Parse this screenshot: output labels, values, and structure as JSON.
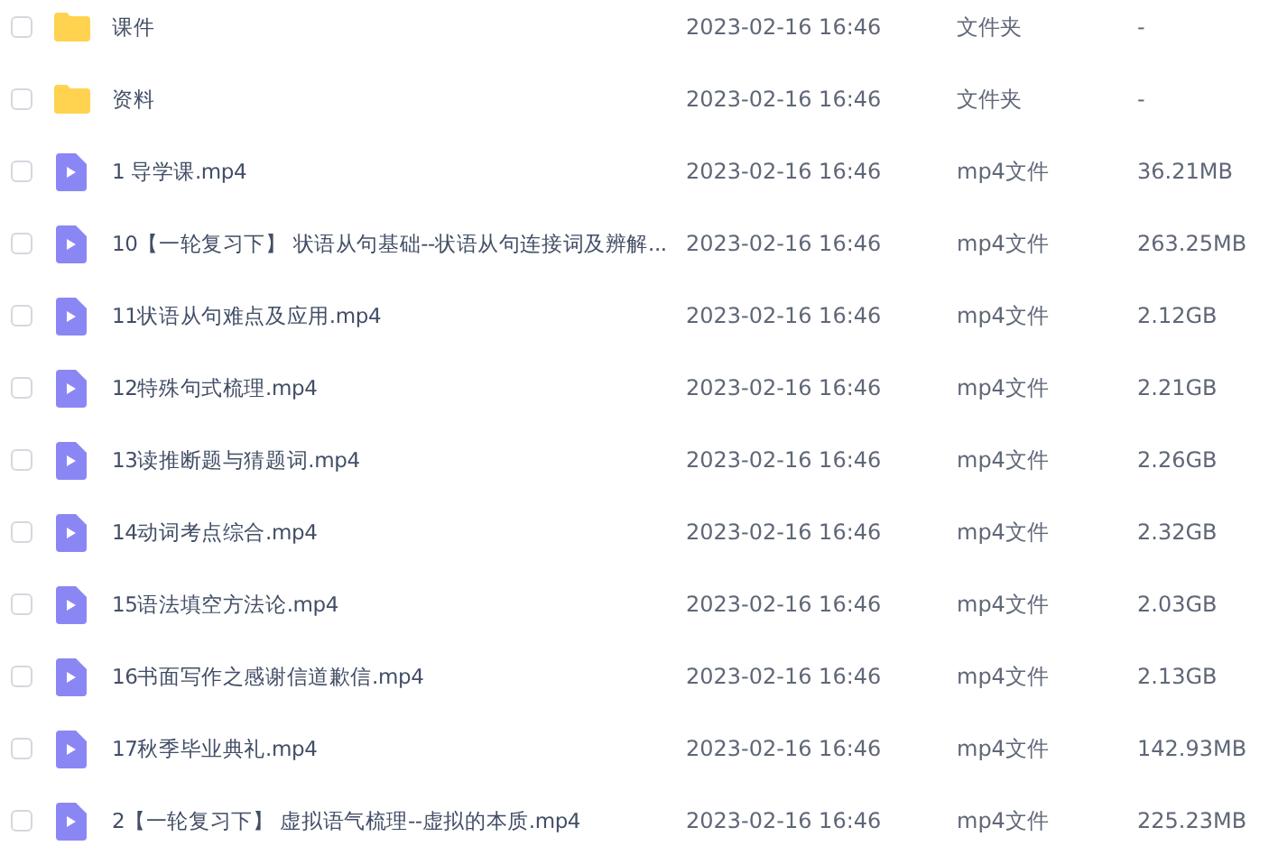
{
  "files": [
    {
      "kind": "folder",
      "name": "课件",
      "modified": "2023-02-16 16:46",
      "type": "文件夹",
      "size": "-",
      "checked": false
    },
    {
      "kind": "folder",
      "name": "资料",
      "modified": "2023-02-16 16:46",
      "type": "文件夹",
      "size": "-",
      "checked": false
    },
    {
      "kind": "video",
      "name": "1  导学课.mp4",
      "modified": "2023-02-16 16:46",
      "type": "mp4文件",
      "size": "36.21MB",
      "checked": false
    },
    {
      "kind": "video",
      "name": "10【一轮复习下】 状语从句基础--状语从句连接词及辨解...",
      "modified": "2023-02-16 16:46",
      "type": "mp4文件",
      "size": "263.25MB",
      "checked": false
    },
    {
      "kind": "video",
      "name": "11状语从句难点及应用.mp4",
      "modified": "2023-02-16 16:46",
      "type": "mp4文件",
      "size": "2.12GB",
      "checked": false
    },
    {
      "kind": "video",
      "name": "12特殊句式梳理.mp4",
      "modified": "2023-02-16 16:46",
      "type": "mp4文件",
      "size": "2.21GB",
      "checked": false
    },
    {
      "kind": "video",
      "name": "13读推断题与猜题词.mp4",
      "modified": "2023-02-16 16:46",
      "type": "mp4文件",
      "size": "2.26GB",
      "checked": false
    },
    {
      "kind": "video",
      "name": "14动词考点综合.mp4",
      "modified": "2023-02-16 16:46",
      "type": "mp4文件",
      "size": "2.32GB",
      "checked": false
    },
    {
      "kind": "video",
      "name": "15语法填空方法论.mp4",
      "modified": "2023-02-16 16:46",
      "type": "mp4文件",
      "size": "2.03GB",
      "checked": false
    },
    {
      "kind": "video",
      "name": "16书面写作之感谢信道歉信.mp4",
      "modified": "2023-02-16 16:46",
      "type": "mp4文件",
      "size": "2.13GB",
      "checked": false
    },
    {
      "kind": "video",
      "name": "17秋季毕业典礼.mp4",
      "modified": "2023-02-16 16:46",
      "type": "mp4文件",
      "size": "142.93MB",
      "checked": false
    },
    {
      "kind": "video",
      "name": "2【一轮复习下】  虚拟语气梳理--虚拟的本质.mp4",
      "modified": "2023-02-16 16:46",
      "type": "mp4文件",
      "size": "225.23MB",
      "checked": false
    }
  ]
}
